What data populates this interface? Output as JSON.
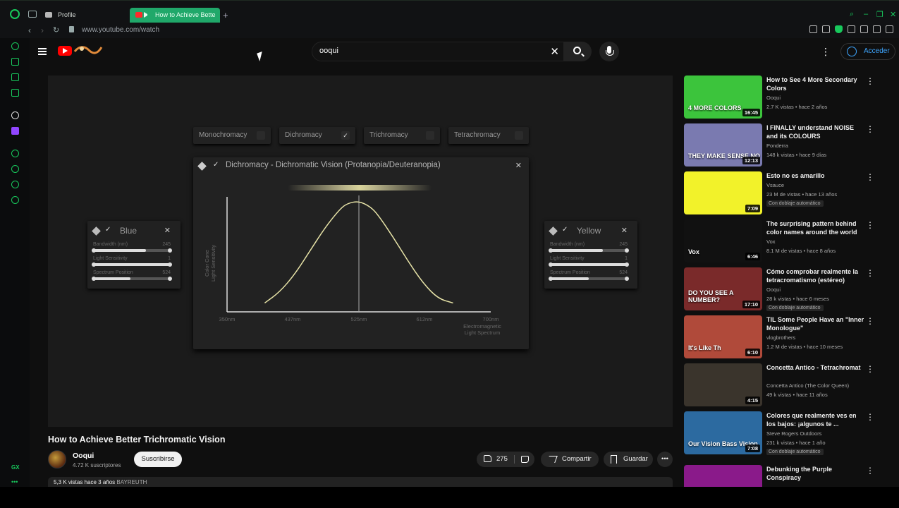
{
  "browser": {
    "tabs": [
      {
        "label": "Profile"
      },
      {
        "label": "How to Achieve Bette"
      }
    ],
    "url": "www.youtube.com/watch"
  },
  "youtube": {
    "search_value": "ooqui",
    "signin_label": "Acceder",
    "colors": {
      "brand": "#ff0000",
      "accent": "#3ea6ff",
      "opera": "#18c85c"
    }
  },
  "video": {
    "toggles": [
      {
        "label": "Monochromacy",
        "checked": false
      },
      {
        "label": "Dichromacy",
        "checked": true
      },
      {
        "label": "Trichromacy",
        "checked": false
      },
      {
        "label": "Tetrachromacy",
        "checked": false
      }
    ],
    "panel_title": "Dichromacy - Dichromatic Vision (Protanopia/Deuteranopia)",
    "blue_panel": {
      "name": "Blue",
      "sliders": [
        {
          "label": "Bandwidth (nm)",
          "value": "245",
          "level": 0.68
        },
        {
          "label": "Light Sensitivity",
          "value": "1",
          "level": 1.0
        },
        {
          "label": "Spectrum Position",
          "value": "524",
          "level": 0.48
        }
      ]
    },
    "yellow_panel": {
      "name": "Yellow",
      "sliders": [
        {
          "label": "Bandwidth (nm)",
          "value": "245",
          "level": 0.68
        },
        {
          "label": "Light Sensitivity",
          "value": "1",
          "level": 1.0
        },
        {
          "label": "Spectrum Position",
          "value": "524",
          "level": 0.5
        }
      ]
    },
    "title": "How to Achieve Better Trichromatic Vision",
    "channel": "Ooqui",
    "subscribers": "4.72 K suscriptores",
    "subscribe_label": "Suscribirse",
    "likes": "275",
    "share_label": "Compartir",
    "save_label": "Guardar",
    "description_stats": "5,3 K vistas  hace 3 años",
    "description_tag": "BAYREUTH"
  },
  "chart_data": {
    "type": "line",
    "title": "",
    "xlabel": "Electromagnetic Light Spectrum",
    "ylabel": "Color Cone Light Sensitivity",
    "x_ticks": [
      "350nm",
      "437nm",
      "525nm",
      "612nm",
      "700nm"
    ],
    "xlim": [
      350,
      700
    ],
    "ylim": [
      0,
      1
    ],
    "grid": false,
    "series": [
      {
        "x": [
          400,
          420,
          440,
          460,
          480,
          500,
          510,
          525,
          540,
          550,
          570,
          590,
          610,
          630,
          650
        ],
        "values": [
          0.08,
          0.18,
          0.34,
          0.55,
          0.76,
          0.93,
          0.98,
          1.0,
          0.95,
          0.88,
          0.68,
          0.46,
          0.26,
          0.12,
          0.08
        ]
      }
    ],
    "annotations": [
      {
        "x": 525,
        "type": "vertical-line"
      }
    ]
  },
  "recommendations": [
    {
      "title": "How  to See 4 More Secondary Colors",
      "channel": "Ooqui",
      "meta": "2.7 K vistas • hace 2 años",
      "duration": "16:45",
      "badge": "",
      "thumb_text": "4 MORE COLORS",
      "thumb_color": "#3cc43c"
    },
    {
      "title": "I FINALLY understand NOISE and its COLOURS",
      "channel": "Ponderra",
      "meta": "148 k vistas • hace 9 días",
      "duration": "12:13",
      "badge": "",
      "thumb_text": "THEY MAKE SENSE NO",
      "thumb_color": "#7a7ab0"
    },
    {
      "title": "Esto no es amarillo",
      "channel": "Vsauce",
      "meta": "23 M de vistas • hace 13 años",
      "duration": "7:09",
      "badge": "Con doblaje automático",
      "thumb_text": "",
      "thumb_color": "#f2f22a"
    },
    {
      "title": "The surprising pattern behind color names around the world",
      "channel": "Vox",
      "meta": "8.1 M de vistas • hace 8 años",
      "duration": "6:46",
      "badge": "",
      "thumb_text": "Vox",
      "thumb_color": "#111111"
    },
    {
      "title": "Cómo comprobar realmente la tetracromatismo (estéreo)",
      "channel": "Ooqui",
      "meta": "28 k vistas • hace 6 meses",
      "duration": "17:10",
      "badge": "Con doblaje automático",
      "thumb_text": "DO YOU SEE A NUMBER?",
      "thumb_color": "#7a2a2a"
    },
    {
      "title": "TIL Some People Have an \"Inner Monologue\"",
      "channel": "vlogbrothers",
      "meta": "1.2 M de vistas • hace 10 meses",
      "duration": "6:10",
      "badge": "",
      "thumb_text": "It's Like Th",
      "thumb_color": "#b04a3a"
    },
    {
      "title": "Concetta Antico - Tetrachromat",
      "channel": "Concetta Antico (The Color Queen)",
      "meta": "49 k vistas • hace 11 años",
      "duration": "4:15",
      "badge": "",
      "thumb_text": "",
      "thumb_color": "#3a342c"
    },
    {
      "title": "Colores que realmente ves en los bajos: ¡algunos te ...",
      "channel": "Steve Rogers Outdoors",
      "meta": "231 k vistas • hace 1 año",
      "duration": "7:08",
      "badge": "Con doblaje automático",
      "thumb_text": "Our Vision  Bass Vision",
      "thumb_color": "#2c6aa0"
    },
    {
      "title": "Debunking the Purple Conspiracy",
      "channel": "",
      "meta": "",
      "duration": "",
      "badge": "",
      "thumb_text": "",
      "thumb_color": "#8a1a8a"
    }
  ]
}
